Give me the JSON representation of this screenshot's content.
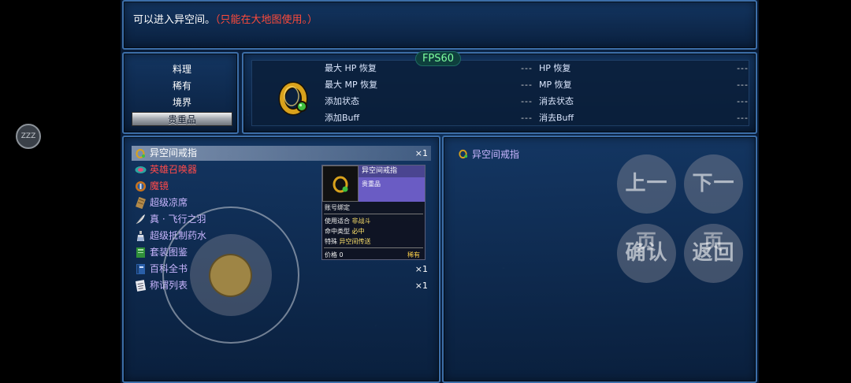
{
  "message": {
    "text": "可以进入异空间。",
    "note": "（只能在大地图使用。）"
  },
  "categories": [
    {
      "label": "料理"
    },
    {
      "label": "稀有"
    },
    {
      "label": "境界"
    },
    {
      "label": "贵重品",
      "selected": true
    }
  ],
  "fps": "FPS60",
  "stats": {
    "left": [
      {
        "label": "最大 HP 恢复",
        "value": "---"
      },
      {
        "label": "最大 MP 恢复",
        "value": "---"
      },
      {
        "label": "添加状态",
        "value": "---"
      },
      {
        "label": "添加Buff",
        "value": "---"
      }
    ],
    "right": [
      {
        "label": "HP 恢复",
        "value": "---"
      },
      {
        "label": "MP 恢复",
        "value": "---"
      },
      {
        "label": "消去状态",
        "value": "---"
      },
      {
        "label": "消去Buff",
        "value": "---"
      }
    ]
  },
  "items": [
    {
      "name": "异空间戒指",
      "count": "×1",
      "color": "#ffffff",
      "icon": "ring-icon"
    },
    {
      "name": "英雄召唤器",
      "count": "",
      "color": "#ff4a4a",
      "icon": "summoner-icon"
    },
    {
      "name": "魔镜",
      "count": "",
      "color": "#ff4a4a",
      "icon": "mirror-icon"
    },
    {
      "name": "超级凉席",
      "count": "",
      "color": "#c9b6ff",
      "icon": "mat-icon"
    },
    {
      "name": "真 · 飞行之羽",
      "count": "",
      "color": "#c9b6ff",
      "icon": "feather-icon"
    },
    {
      "name": "超级抵制药水",
      "count": "",
      "color": "#c9b6ff",
      "icon": "potion-icon"
    },
    {
      "name": "套装图鉴",
      "count": "",
      "color": "#c9b6ff",
      "icon": "book-icon"
    },
    {
      "name": "百科全书",
      "count": "×1",
      "color": "#c9b6ff",
      "icon": "encyclopedia-icon"
    },
    {
      "name": "称谓列表",
      "count": "×1",
      "color": "#c9b6ff",
      "icon": "list-icon"
    }
  ],
  "detail": {
    "title": "异空间戒指"
  },
  "tooltip": {
    "title": "异空间戒指",
    "type": "贵重品",
    "bind": "账号绑定",
    "use_label": "使用适合",
    "use_value": "非战斗",
    "hit_label": "命中类型",
    "hit_value": "必中",
    "special_label": "特殊",
    "special_value": "异空间传送",
    "price": "价格 0",
    "rarity": "稀有"
  },
  "controls": {
    "prev": "上一页",
    "next": "下一页",
    "confirm": "确认",
    "back": "返回"
  },
  "zzz": "ZZZ"
}
